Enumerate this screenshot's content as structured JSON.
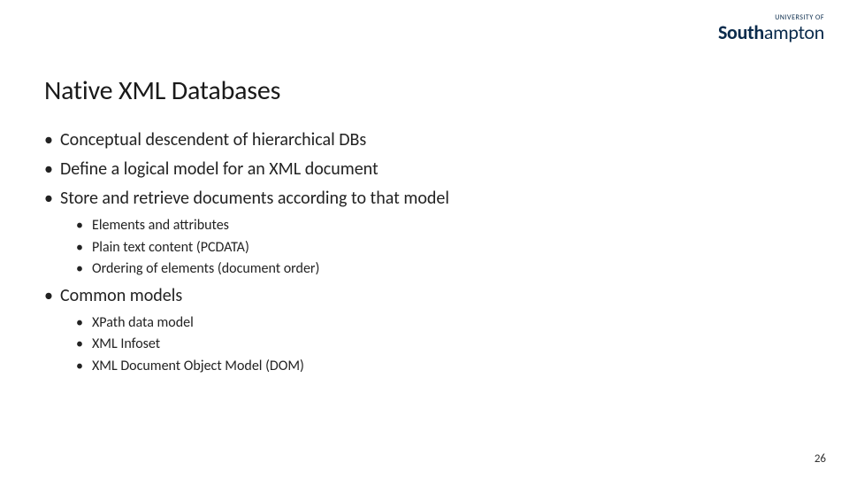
{
  "logo": {
    "topline": "UNIVERSITY OF",
    "main_prefix": "South",
    "main_suffix": "ampton"
  },
  "title": "Native XML Databases",
  "bullets": [
    {
      "text": "Conceptual descendent of hierarchical DBs",
      "sub": []
    },
    {
      "text": "Define a logical model for an XML document",
      "sub": []
    },
    {
      "text": "Store and retrieve documents according to that model",
      "sub": [
        "Elements and attributes",
        "Plain text content (PCDATA)",
        "Ordering of elements (document order)"
      ]
    },
    {
      "text": "Common models",
      "sub": [
        "XPath data model",
        "XML Infoset",
        "XML Document Object Model (DOM)"
      ]
    }
  ],
  "page_number": "26"
}
